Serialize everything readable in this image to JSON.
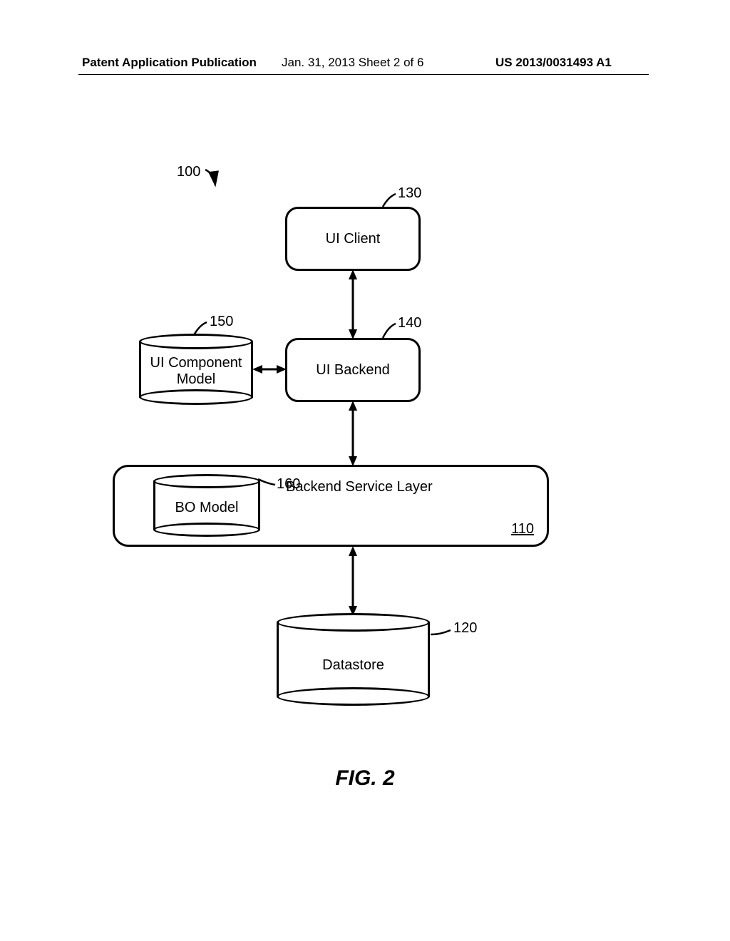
{
  "header": {
    "left": "Patent Application Publication",
    "mid": "Jan. 31, 2013  Sheet 2 of 6",
    "right": "US 2013/0031493 A1"
  },
  "refs": {
    "r100": "100",
    "r130": "130",
    "r150": "150",
    "r140": "140",
    "r160": "160",
    "r110": "110",
    "r120": "120"
  },
  "labels": {
    "ui_client": "UI Client",
    "ui_backend": "UI Backend",
    "ui_component_model": "UI Component\nModel",
    "backend_service_layer": "Backend Service Layer",
    "bo_model": "BO Model",
    "datastore": "Datastore"
  },
  "figure_caption": "FIG.  2"
}
